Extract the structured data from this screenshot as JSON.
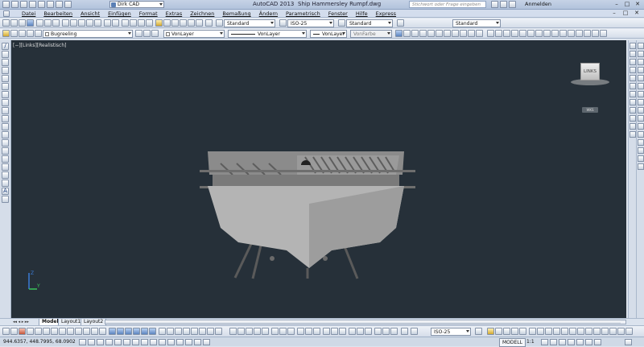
{
  "titlebar": {
    "workspace": "Dirk CAD",
    "app_title": "AutoCAD 2013",
    "doc_title": "Ship Hammersley Rumpf.dwg",
    "search_placeholder": "Stichwort oder Frage eingeben",
    "login": "Anmelden",
    "min": "–",
    "max": "□",
    "close": "✕"
  },
  "menu": {
    "items": [
      "Datei",
      "Bearbeiten",
      "Ansicht",
      "Einfügen",
      "Format",
      "Extras",
      "Zeichnen",
      "Bemaßung",
      "Ändern",
      "Parametrisch",
      "Fenster",
      "Hilfe",
      "Express"
    ]
  },
  "toolbar1": {
    "text_style": "Standard",
    "dim_style": "ISO-25",
    "table_style": "Standard",
    "mleader_style": "Standard"
  },
  "toolbar2": {
    "layer": "Bugreeling",
    "color": "VonLayer",
    "linetype": "VonLayer",
    "lineweight": "VonLayer",
    "plotstyle": "VonFarbe"
  },
  "viewport": {
    "label": "[−][Links][Realistisch]",
    "viewcube_face": "LINKS",
    "wcs": "WKS",
    "ucs_y": "Y",
    "ucs_z": "Z"
  },
  "tabs": {
    "model": "Modell",
    "layout1": "Layout1",
    "layout2": "Layout2",
    "nav": "◂◂ ◂ ▸ ▸▸"
  },
  "bottom_toolbar": {
    "dim_style": "ISO-25"
  },
  "status": {
    "coords": "944.6357, 448.7995, 68.0902",
    "model": "MODELL",
    "scale": "1:1"
  },
  "colors": {
    "viewport_bg": "#263039",
    "chrome": "#d5dde9"
  }
}
